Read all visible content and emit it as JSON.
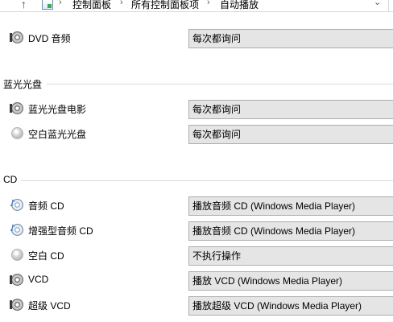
{
  "address_bar": {
    "up_icon": "up-arrow-icon",
    "location_icon": "control-panel-icon",
    "separator": "›",
    "crumbs": [
      "控制面板",
      "所有控制面板项",
      "自动播放"
    ],
    "dropdown_icon": "chevron-down-icon"
  },
  "dvd": {
    "rows": [
      {
        "label": "DVD 音频",
        "icon": "disc-icon",
        "value": "每次都询问"
      }
    ]
  },
  "bluray": {
    "title": "蓝光光盘",
    "rows": [
      {
        "label": "蓝光光盘电影",
        "icon": "disc-icon",
        "value": "每次都询问"
      },
      {
        "label": "空白蓝光光盘",
        "icon": "blank-disc-icon",
        "value": "每次都询问"
      }
    ]
  },
  "cd": {
    "title": "CD",
    "rows": [
      {
        "label": "音频 CD",
        "icon": "audio-cd-icon",
        "value": "播放音频 CD (Windows Media Player)"
      },
      {
        "label": "增强型音频 CD",
        "icon": "audio-cd-icon",
        "value": "播放音频 CD (Windows Media Player)"
      },
      {
        "label": "空白 CD",
        "icon": "blank-disc-icon",
        "value": "不执行操作"
      },
      {
        "label": "VCD",
        "icon": "disc-icon",
        "value": "播放 VCD (Windows Media Player)"
      },
      {
        "label": "超级 VCD",
        "icon": "disc-icon",
        "value": "播放超级 VCD (Windows Media Player)"
      }
    ]
  }
}
